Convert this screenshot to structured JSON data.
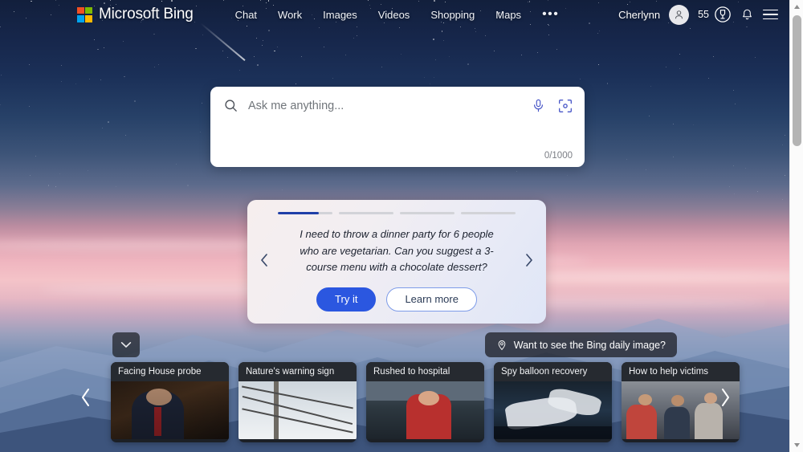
{
  "header": {
    "brand": "Microsoft Bing",
    "brand_icon": "microsoft-logo-icon",
    "nav": [
      {
        "label": "Chat"
      },
      {
        "label": "Work"
      },
      {
        "label": "Images"
      },
      {
        "label": "Videos"
      },
      {
        "label": "Shopping"
      },
      {
        "label": "Maps"
      }
    ],
    "more_label": "•••",
    "account": {
      "username": "Cherlynn",
      "avatar_icon": "person-avatar-icon"
    },
    "rewards": {
      "points": "55",
      "icon": "rewards-trophy-icon"
    },
    "notifications_icon": "bell-icon",
    "menu_icon": "hamburger-menu-icon"
  },
  "search": {
    "placeholder": "Ask me anything...",
    "value": "",
    "counter": "0/1000",
    "search_icon": "search-icon",
    "mic_icon": "microphone-icon",
    "visual_search_icon": "visual-search-icon"
  },
  "suggestion_card": {
    "segments": [
      {
        "filled": 75
      },
      {
        "filled": 0
      },
      {
        "filled": 0
      },
      {
        "filled": 0
      }
    ],
    "prompt": "I need to throw a dinner party for 6 people who are vegetarian. Can you suggest a 3-course menu with a chocolate dessert?",
    "primary_button": "Try it",
    "secondary_button": "Learn more",
    "prev_icon": "chevron-left-icon",
    "next_icon": "chevron-right-icon"
  },
  "controls": {
    "collapse_icon": "chevron-down-icon",
    "daily_image": {
      "label": "Want to see the Bing daily image?",
      "icon": "location-pin-icon"
    }
  },
  "news": {
    "prev_icon": "chevron-left-icon",
    "next_icon": "chevron-right-icon",
    "cards": [
      {
        "title": "Facing House probe"
      },
      {
        "title": "Nature's warning sign"
      },
      {
        "title": "Rushed to hospital"
      },
      {
        "title": "Spy balloon recovery"
      },
      {
        "title": "How to help victims"
      }
    ]
  },
  "scrollbar": {
    "up_icon": "scroll-up-arrow-icon",
    "down_icon": "scroll-down-arrow-icon"
  },
  "colors": {
    "accent_blue": "#2b57e0",
    "progress_blue": "#1f3fa8",
    "logo_red": "#f25022",
    "logo_green": "#7fba00",
    "logo_blue": "#00a4ef",
    "logo_yellow": "#ffb900"
  }
}
